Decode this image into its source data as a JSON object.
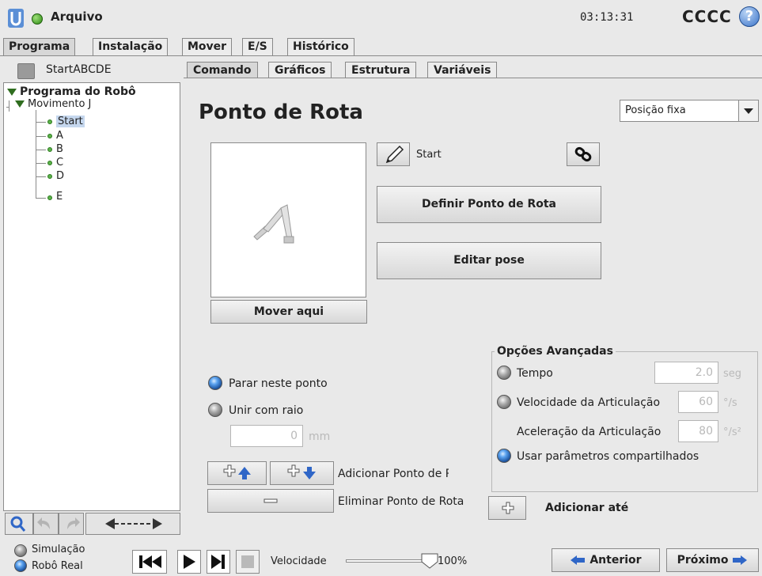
{
  "header": {
    "file_menu": "Arquivo",
    "clock": "03:13:31",
    "robot_name": "CCCC",
    "help_symbol": "?",
    "status_color": "#3aa31a"
  },
  "main_tabs": [
    {
      "label": "Programa",
      "active": true
    },
    {
      "label": "Instalação",
      "active": false
    },
    {
      "label": "Mover",
      "active": false
    },
    {
      "label": "E/S",
      "active": false
    },
    {
      "label": "Histórico",
      "active": false
    }
  ],
  "program": {
    "name": "StartABCDE",
    "tree": {
      "root": "Programa do Robô",
      "move": "Movimento J",
      "waypoints": [
        "Start",
        "A",
        "B",
        "C",
        "D",
        "E"
      ],
      "selected": "Start"
    }
  },
  "sub_tabs": [
    {
      "label": "Comando",
      "active": true
    },
    {
      "label": "Gráficos",
      "active": false
    },
    {
      "label": "Estrutura",
      "active": false
    },
    {
      "label": "Variáveis",
      "active": false
    }
  ],
  "waypoint": {
    "title": "Ponto de Rota",
    "type_select": "Posição fixa",
    "name": "Start",
    "set_button": "Definir Ponto de Rota",
    "edit_button": "Editar pose",
    "move_here_button": "Mover aqui",
    "stop_option": "Parar neste ponto",
    "blend_option": "Unir com raio",
    "blend_value": "0",
    "blend_unit": "mm",
    "add_label": "Adicionar Ponto de Rota",
    "delete_label": "Eliminar Ponto de Rota",
    "add_until": "Adicionar até"
  },
  "advanced": {
    "title": "Opções Avançadas",
    "time_label": "Tempo",
    "time_value": "2.0",
    "time_unit": "seg",
    "joint_speed_label": "Velocidade da Articulação",
    "joint_speed_value": "60",
    "joint_speed_unit": "°/s",
    "joint_accel_label": "Aceleração da Articulação",
    "joint_accel_value": "80",
    "joint_accel_unit": "°/s²",
    "shared_label": "Usar parâmetros compartilhados"
  },
  "footer": {
    "simulation": "Simulação",
    "real_robot": "Robô Real",
    "speed_label": "Velocidade",
    "speed_value": "100%",
    "speed_fraction": 1.0,
    "prev_button": "Anterior",
    "next_button": "Próximo"
  }
}
